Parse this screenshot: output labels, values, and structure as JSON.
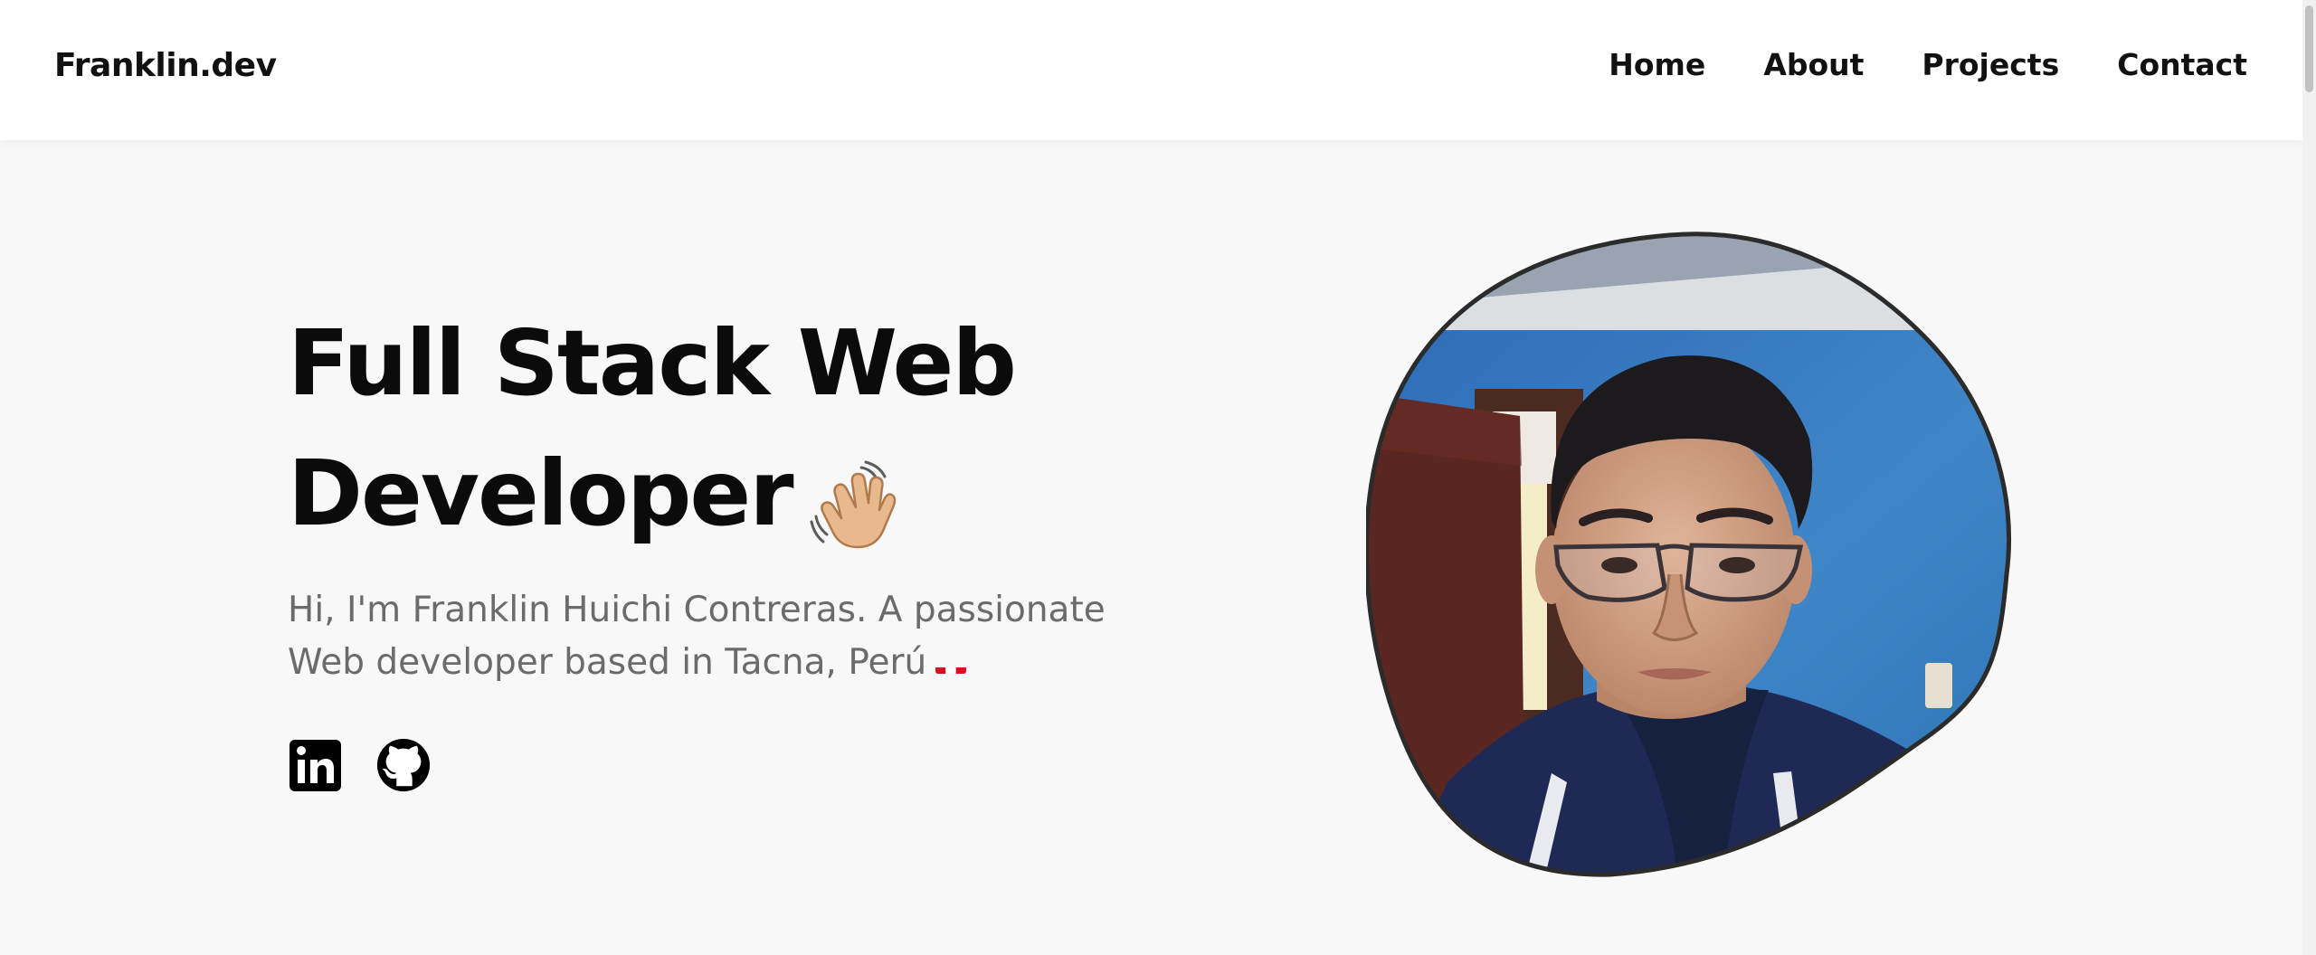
{
  "header": {
    "brand": "Franklin.dev",
    "nav": [
      {
        "label": "Home"
      },
      {
        "label": "About"
      },
      {
        "label": "Projects"
      },
      {
        "label": "Contact"
      }
    ]
  },
  "hero": {
    "title_line1": "Full Stack Web",
    "title_line2": "Developer",
    "wave_icon": "waving-hand-icon",
    "subtitle": "Hi, I'm Franklin Huichi Contreras. A passionate Web developer based in Tacna, Perú",
    "flag_icon": "peru-flag-icon",
    "social": [
      {
        "name": "linkedin-icon"
      },
      {
        "name": "github-icon"
      }
    ]
  },
  "colors": {
    "background": "#f8f8f8",
    "header_bg": "#ffffff",
    "text": "#0b0b0b",
    "muted_text": "#6b6b6b",
    "accent_blue": "#3b84c6",
    "peru_red": "#d91023"
  }
}
